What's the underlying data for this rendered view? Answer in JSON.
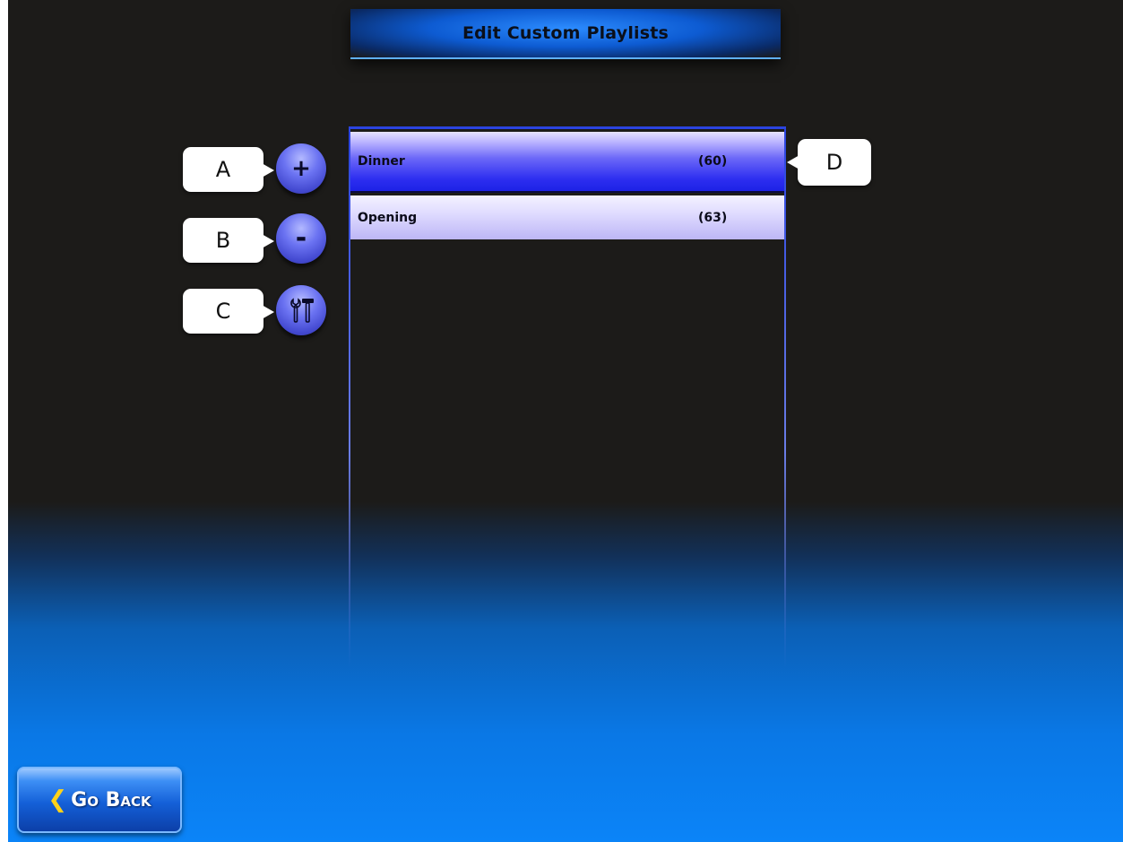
{
  "header": {
    "title": "Edit Custom Playlists"
  },
  "playlists": [
    {
      "name": "Dinner",
      "count": "(60)",
      "selected": true
    },
    {
      "name": "Opening",
      "count": "(63)",
      "selected": false
    }
  ],
  "side_buttons": {
    "add_glyph": "+",
    "remove_glyph": "-",
    "tools_icon": "tools-icon"
  },
  "callouts": {
    "a": "A",
    "b": "B",
    "c": "C",
    "d": "D"
  },
  "footer": {
    "back_label": "Go Back",
    "back_icon": "chevron-left-icon"
  },
  "colors": {
    "selected_row": "#2d2ef0",
    "button_accent": "#6b73f2",
    "chevron": "#ffd21a"
  }
}
